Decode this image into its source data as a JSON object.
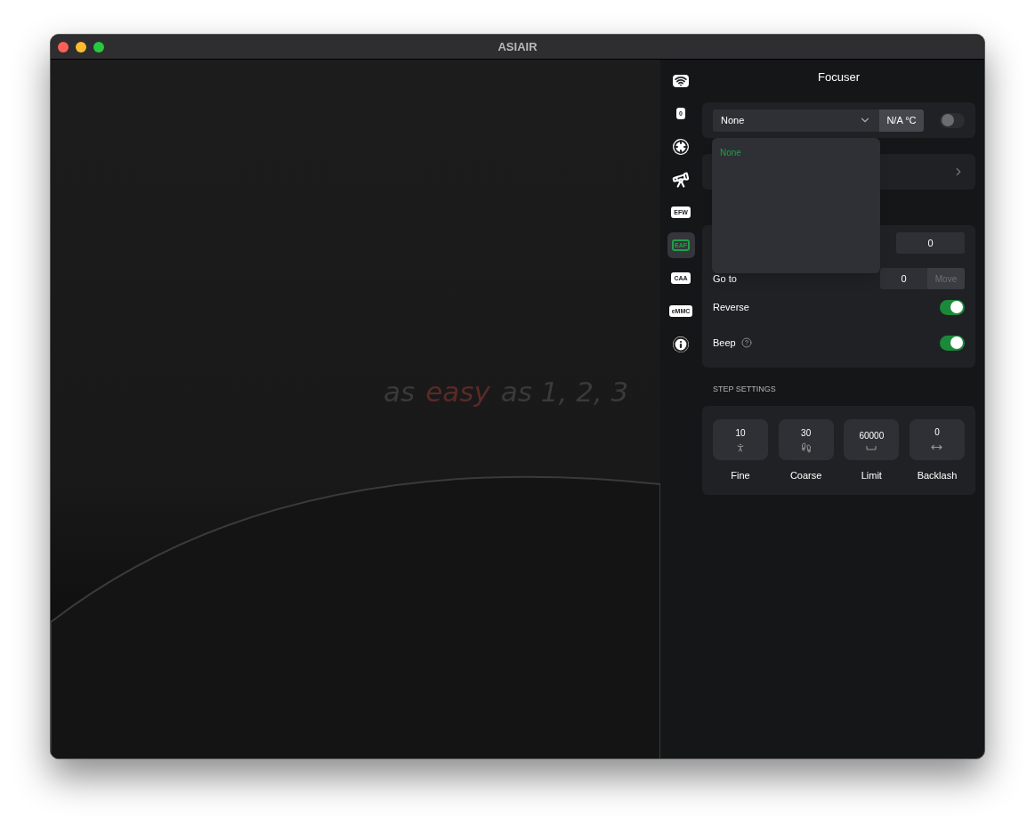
{
  "window": {
    "title": "ASIAIR"
  },
  "tagline": [
    {
      "text": "as",
      "kind": "plain"
    },
    {
      "text": "easy",
      "kind": "accent"
    },
    {
      "text": "as 1, 2, 3",
      "kind": "plain"
    }
  ],
  "sidebar": {
    "items": [
      {
        "kind": "wifi",
        "selected": false
      },
      {
        "kind": "camera",
        "label": "0",
        "selected": false
      },
      {
        "kind": "guide",
        "selected": false
      },
      {
        "kind": "mount",
        "selected": false
      },
      {
        "kind": "filter",
        "label": "EFW",
        "selected": false
      },
      {
        "kind": "focuser",
        "label": "EAF",
        "selected": true
      },
      {
        "kind": "rotator",
        "label": "CAA",
        "selected": false
      },
      {
        "kind": "storage",
        "label": "eMMC",
        "selected": false
      },
      {
        "kind": "info",
        "selected": false
      }
    ]
  },
  "panel": {
    "title": "Focuser",
    "device": {
      "value": "None",
      "temperature": "N/A °C",
      "connected": false,
      "menu": {
        "options": [
          {
            "label": "None",
            "selected": true
          }
        ]
      }
    },
    "position": {
      "value": "0"
    },
    "goto": {
      "label": "Go to",
      "value": "0",
      "button": "Move",
      "disabled": true
    },
    "toggles": [
      {
        "label": "Reverse",
        "on": true,
        "help": false
      },
      {
        "label": "Beep",
        "on": true,
        "help": true
      }
    ],
    "step_settings": {
      "heading": "STEP SETTINGS",
      "tiles": [
        {
          "kind": "walk",
          "value": "10",
          "label": "Fine"
        },
        {
          "kind": "run",
          "value": "30",
          "label": "Coarse"
        },
        {
          "kind": "limit",
          "value": "60000",
          "label": "Limit"
        },
        {
          "kind": "backlash",
          "value": "0",
          "label": "Backlash"
        }
      ]
    }
  }
}
